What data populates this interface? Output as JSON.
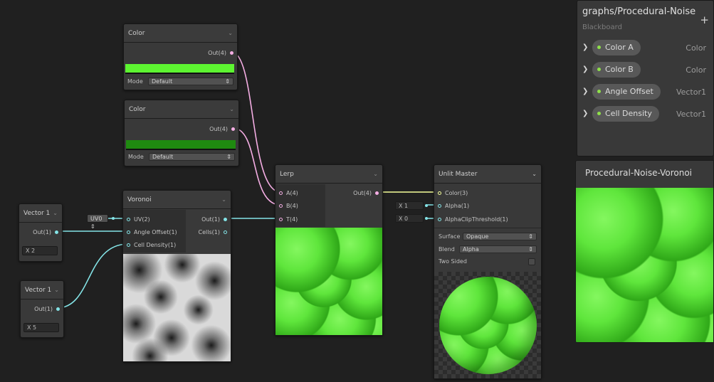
{
  "nodes": {
    "color_a": {
      "title": "Color",
      "out": "Out(4)",
      "mode_label": "Mode",
      "mode_value": "Default",
      "swatch": "#5df531"
    },
    "color_b": {
      "title": "Color",
      "out": "Out(4)",
      "mode_label": "Mode",
      "mode_value": "Default",
      "swatch": "#1f8a10"
    },
    "vector1_a": {
      "title": "Vector 1",
      "out": "Out(1)",
      "value": "X 2"
    },
    "vector1_b": {
      "title": "Vector 1",
      "out": "Out(1)",
      "value": "X 5"
    },
    "voronoi": {
      "title": "Voronoi",
      "uv_input": "UV0",
      "inputs": [
        "UV(2)",
        "Angle Offset(1)",
        "Cell Density(1)"
      ],
      "outputs": [
        "Out(1)",
        "Cells(1)"
      ]
    },
    "lerp": {
      "title": "Lerp",
      "inputs": [
        "A(4)",
        "B(4)",
        "T(4)"
      ],
      "output": "Out(4)"
    },
    "unlit_master": {
      "title": "Unlit Master",
      "inputs": [
        "Color(3)",
        "Alpha(1)",
        "AlphaClipThreshold(1)"
      ],
      "alpha_value": "X 1",
      "clip_value": "X 0",
      "surface_label": "Surface",
      "surface_value": "Opaque",
      "blend_label": "Blend",
      "blend_value": "Alpha",
      "two_sided_label": "Two Sided"
    }
  },
  "blackboard": {
    "title": "graphs/Procedural-Noise",
    "subtitle": "Blackboard",
    "add_label": "+",
    "properties": [
      {
        "name": "Color A",
        "type": "Color"
      },
      {
        "name": "Color B",
        "type": "Color"
      },
      {
        "name": "Angle Offset",
        "type": "Vector1"
      },
      {
        "name": "Cell Density",
        "type": "Vector1"
      }
    ]
  },
  "main_preview": {
    "title": "Procedural-Noise-Voronoi"
  },
  "colors": {
    "background": "#202020",
    "node": "#393939",
    "wire_vector4": "#f5aee4",
    "wire_vector1": "#84e4e7",
    "wire_vector3": "#f6ff9a",
    "property_dot": "#8fe04a"
  }
}
